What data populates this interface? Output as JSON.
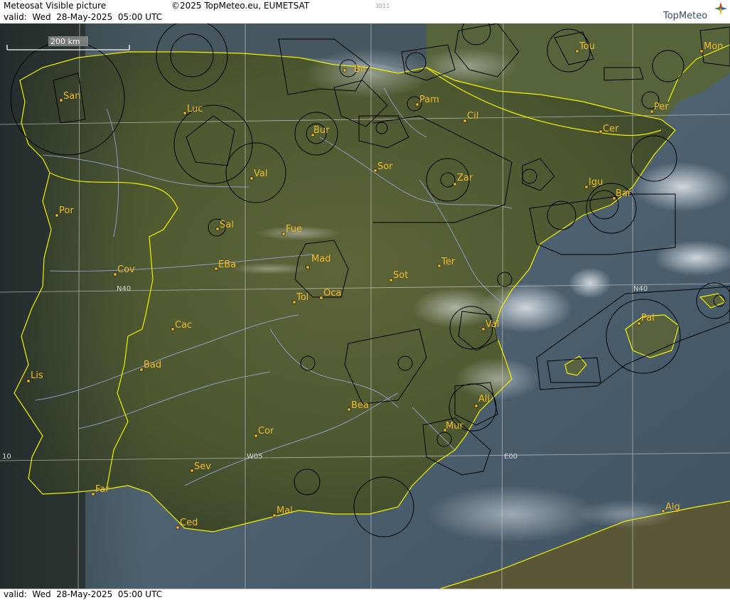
{
  "header": {
    "title": "Meteosat Visible picture",
    "copyright": "©2025 TopMeteo.eu, EUMETSAT",
    "image_id": "3011",
    "valid": "valid:  Wed  28-May-2025  05:00 UTC",
    "logo_text": "TopMeteo"
  },
  "footer": {
    "valid": "valid:  Wed  28-May-2025  05:00 UTC"
  },
  "map": {
    "scale_bar": "200 km",
    "grid_labels": {
      "lat_west": "N40",
      "lat_east": "N40",
      "lon_w10": "10",
      "lon_w05": "W05",
      "lon_e00": "E00"
    },
    "cities": [
      "San",
      "Bil",
      "Pam",
      "Tou",
      "Mon",
      "Luc",
      "Cil",
      "Per",
      "Bur",
      "Cer",
      "Sor",
      "Val",
      "Zar",
      "Igu",
      "Bar",
      "Por",
      "Sal",
      "Fue",
      "Mad",
      "Cov",
      "EBa",
      "Ter",
      "Sot",
      "Tol",
      "Oca",
      "Cac",
      "Val",
      "Pal",
      "Bad",
      "Lis",
      "Ali",
      "Bea",
      "Mur",
      "Cor",
      "Sev",
      "Far",
      "Mal",
      "Alg",
      "Ced"
    ],
    "colors": {
      "coastline": "#f5f000",
      "rivers": "#9aa6e0",
      "airspace": "#000000",
      "city_labels": "#f2b92a",
      "grid": "#cfcfcf",
      "sea": "#54687a",
      "land": "#4f5a34"
    }
  }
}
